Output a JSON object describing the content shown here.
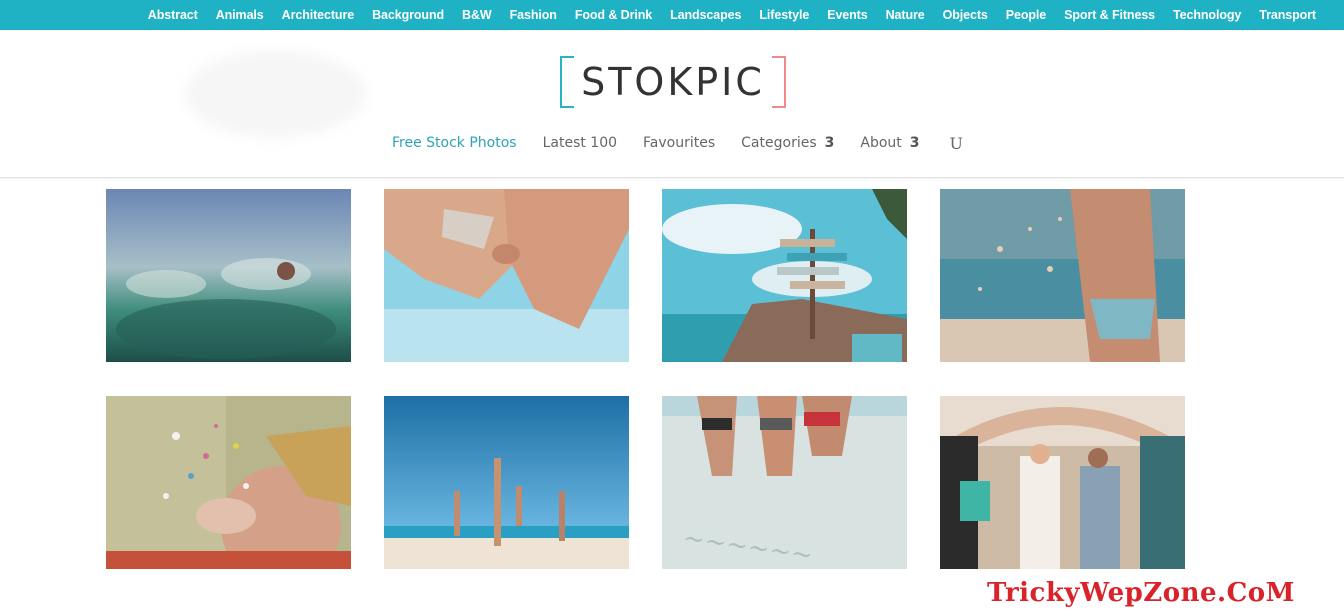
{
  "topbar": {
    "categories": [
      "Abstract",
      "Animals",
      "Architecture",
      "Background",
      "B&W",
      "Fashion",
      "Food & Drink",
      "Landscapes",
      "Lifestyle",
      "Events",
      "Nature",
      "Objects",
      "People",
      "Sport & Fitness",
      "Technology",
      "Transport"
    ]
  },
  "logo": {
    "text": "STOKPIC"
  },
  "nav": {
    "items": [
      {
        "label": "Free Stock Photos",
        "active": true
      },
      {
        "label": "Latest 100"
      },
      {
        "label": "Favourites"
      },
      {
        "label": "Categories",
        "caret": "3"
      },
      {
        "label": "About",
        "caret": "3"
      }
    ],
    "search_glyph": "U"
  },
  "colors": {
    "topbar": "#1fb1c4",
    "active_nav": "#2ea3b8",
    "logo_left_bracket": "#29b4c6",
    "logo_right_bracket": "#f08a8a",
    "watermark": "#d8232a"
  },
  "photos": [
    {
      "name": "photo-water-splash"
    },
    {
      "name": "photo-legs-sky"
    },
    {
      "name": "photo-signpost-beach"
    },
    {
      "name": "photo-sand-throw"
    },
    {
      "name": "photo-confetti-blow"
    },
    {
      "name": "photo-beach-jump"
    },
    {
      "name": "photo-friends-sand"
    },
    {
      "name": "photo-wedding-arch"
    }
  ],
  "watermark": {
    "text": "TrickyWepZone.CoM"
  }
}
